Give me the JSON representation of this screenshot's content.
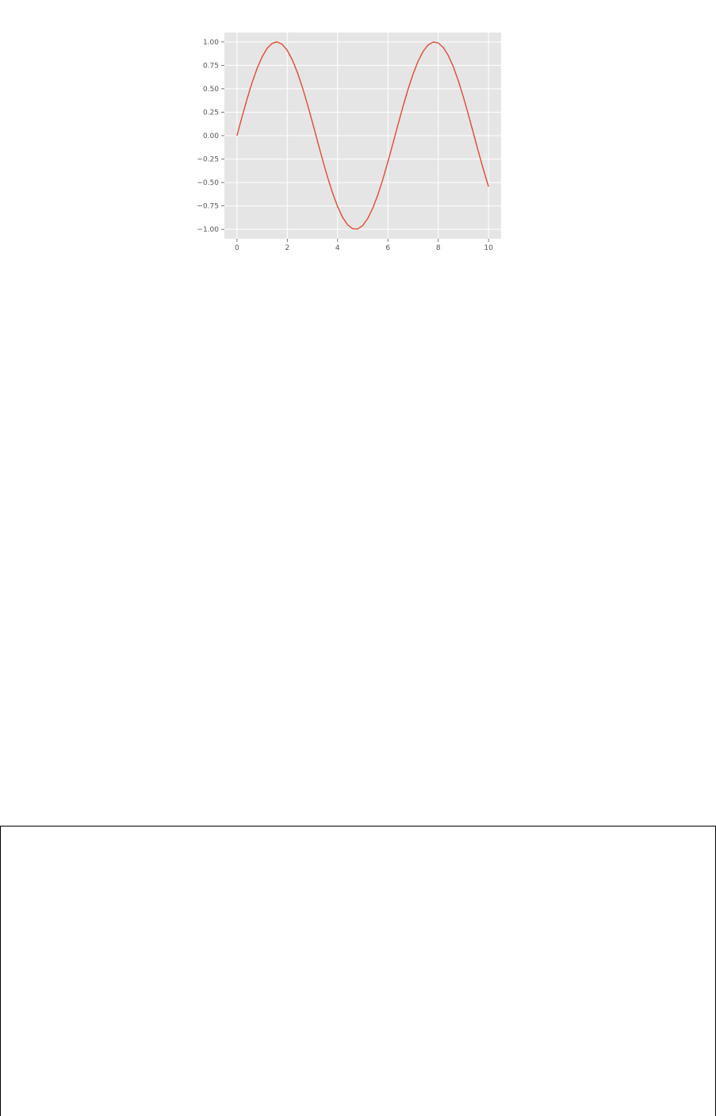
{
  "chart_data": {
    "type": "line",
    "title": "",
    "xlabel": "",
    "ylabel": "",
    "xlim": [
      -0.5,
      10.5
    ],
    "ylim": [
      -1.1,
      1.1
    ],
    "grid": true,
    "background_color": "#e5e5e5",
    "grid_color": "#ffffff",
    "x_ticks": [
      0,
      2,
      4,
      6,
      8,
      10
    ],
    "x_tick_labels": [
      "0",
      "2",
      "4",
      "6",
      "8",
      "10"
    ],
    "y_ticks": [
      1.0,
      0.75,
      0.5,
      0.25,
      0.0,
      -0.25,
      -0.5,
      -0.75,
      -1.0
    ],
    "y_tick_labels": [
      "1.00",
      "0.75",
      "0.50",
      "0.25",
      "0.00",
      "−0.25",
      "−0.50",
      "−0.75",
      "−1.00"
    ],
    "series": [
      {
        "color": "#e24a33",
        "x": [
          0.0,
          0.2,
          0.4,
          0.6,
          0.8,
          1.0,
          1.2,
          1.4,
          1.6,
          1.8,
          2.0,
          2.2,
          2.4,
          2.6,
          2.8,
          3.0,
          3.2,
          3.4,
          3.6,
          3.8,
          4.0,
          4.2,
          4.4,
          4.6,
          4.8,
          5.0,
          5.2,
          5.4,
          5.6,
          5.8,
          6.0,
          6.2,
          6.4,
          6.6,
          6.8,
          7.0,
          7.2,
          7.4,
          7.6,
          7.8,
          8.0,
          8.2,
          8.4,
          8.6,
          8.8,
          9.0,
          9.2,
          9.4,
          9.6,
          9.8,
          10.0
        ],
        "y": [
          0.0,
          0.199,
          0.389,
          0.565,
          0.717,
          0.841,
          0.932,
          0.985,
          1.0,
          0.974,
          0.909,
          0.808,
          0.675,
          0.516,
          0.335,
          0.141,
          -0.058,
          -0.256,
          -0.443,
          -0.612,
          -0.757,
          -0.872,
          -0.952,
          -0.994,
          -0.996,
          -0.959,
          -0.883,
          -0.773,
          -0.631,
          -0.465,
          -0.279,
          -0.083,
          0.117,
          0.312,
          0.494,
          0.657,
          0.794,
          0.899,
          0.968,
          0.999,
          0.989,
          0.941,
          0.855,
          0.734,
          0.585,
          0.412,
          0.223,
          0.025,
          -0.174,
          -0.366,
          -0.544
        ]
      }
    ]
  }
}
